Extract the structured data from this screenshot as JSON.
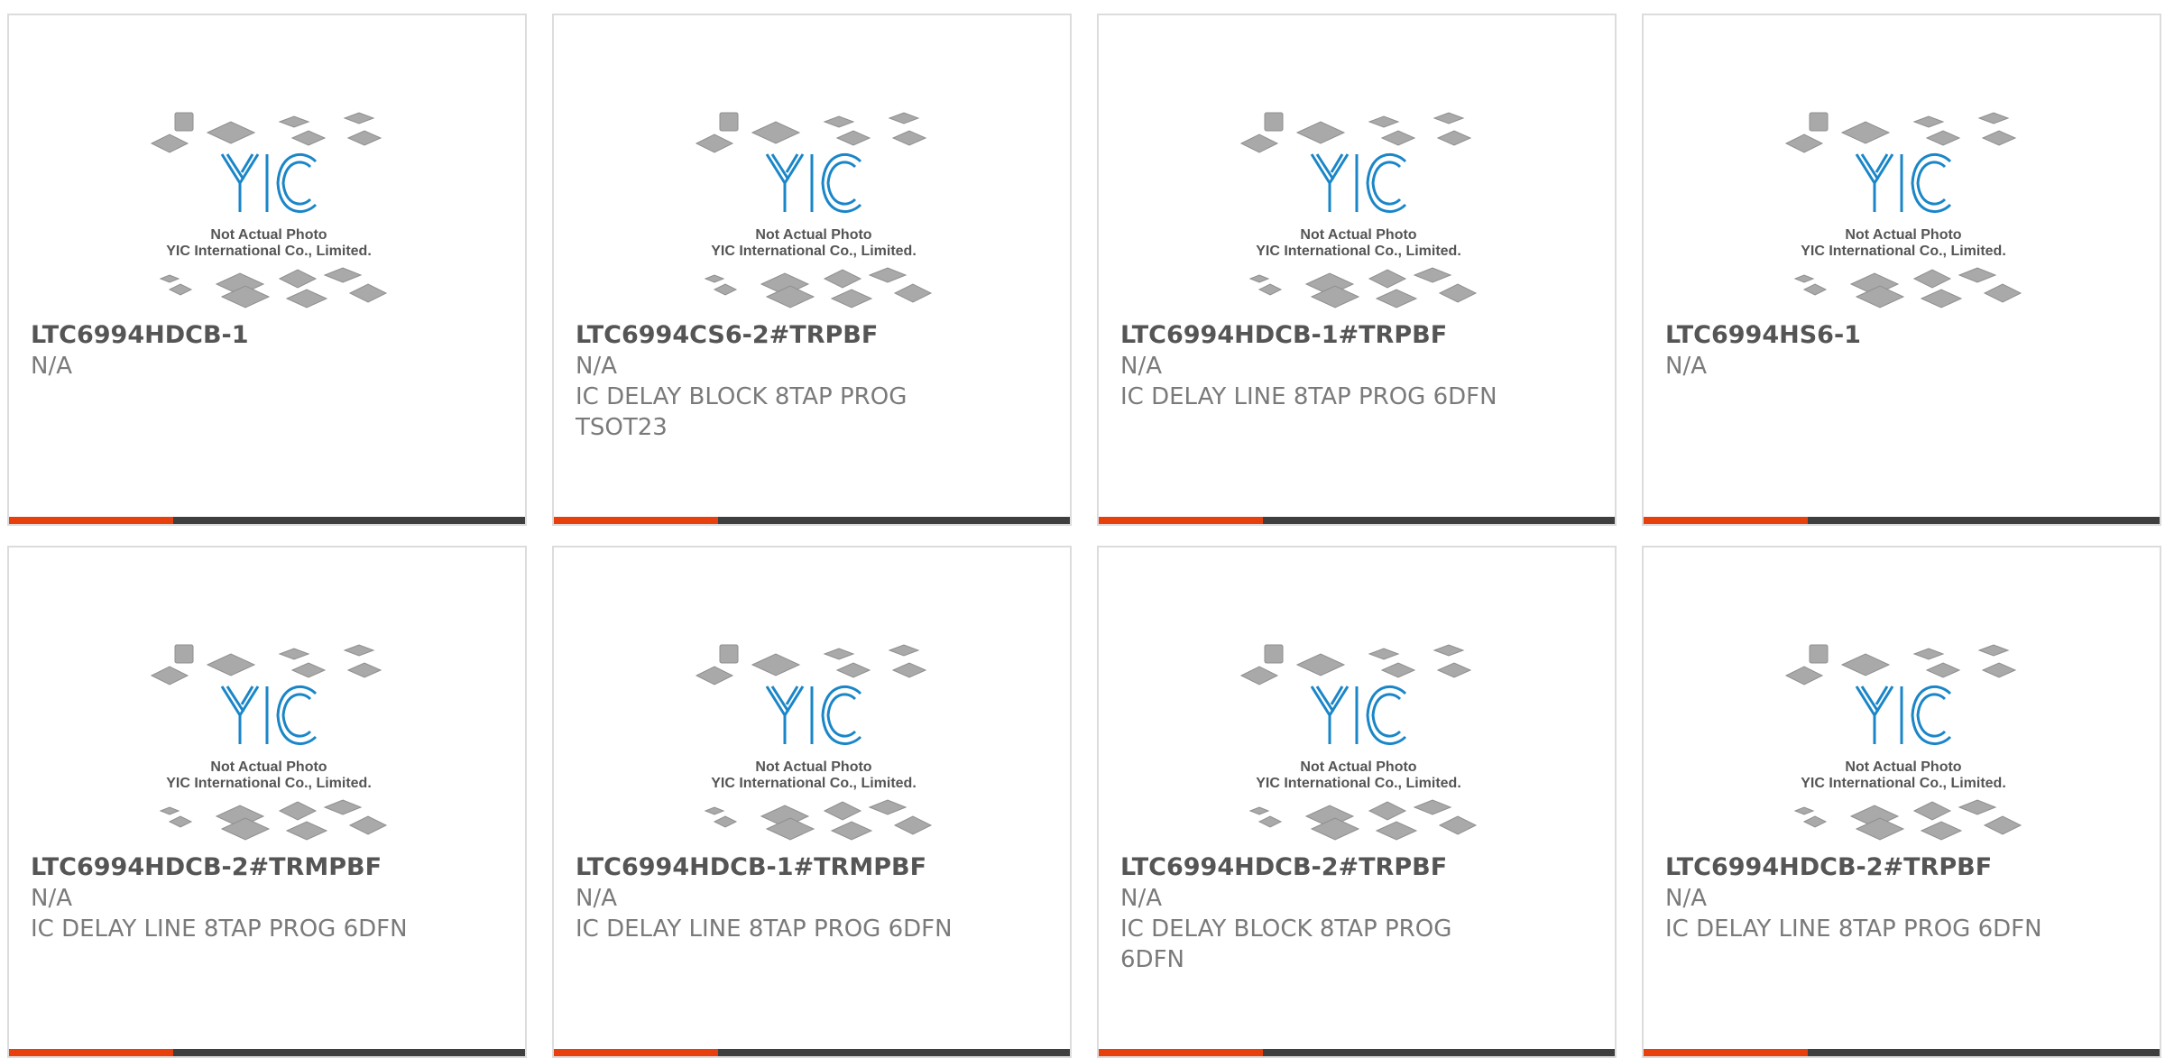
{
  "image_caption": {
    "line1": "Not Actual Photo",
    "line2": "YIC International Co., Limited.",
    "logo_text": "YIC"
  },
  "colors": {
    "accent": "#e8400c",
    "bar": "#3f3f3f",
    "logo_blue": "#1a86c8"
  },
  "products": [
    {
      "part": "LTC6994HDCB-1",
      "brand": "N/A",
      "desc": ""
    },
    {
      "part": "LTC6994CS6-2#TRPBF",
      "brand": "N/A",
      "desc": "IC DELAY BLOCK 8TAP PROG TSOT23"
    },
    {
      "part": "LTC6994HDCB-1#TRPBF",
      "brand": "N/A",
      "desc": "IC DELAY LINE 8TAP PROG 6DFN"
    },
    {
      "part": "LTC6994HS6-1",
      "brand": "N/A",
      "desc": ""
    },
    {
      "part": "LTC6994HDCB-2#TRMPBF",
      "brand": "N/A",
      "desc": "IC DELAY LINE 8TAP PROG 6DFN"
    },
    {
      "part": "LTC6994HDCB-1#TRMPBF",
      "brand": "N/A",
      "desc": "IC DELAY LINE 8TAP PROG 6DFN"
    },
    {
      "part": "LTC6994HDCB-2#TRPBF",
      "brand": "N/A",
      "desc": "IC DELAY BLOCK 8TAP PROG 6DFN"
    },
    {
      "part": "LTC6994HDCB-2#TRPBF",
      "brand": "N/A",
      "desc": "IC DELAY LINE 8TAP PROG 6DFN"
    }
  ]
}
